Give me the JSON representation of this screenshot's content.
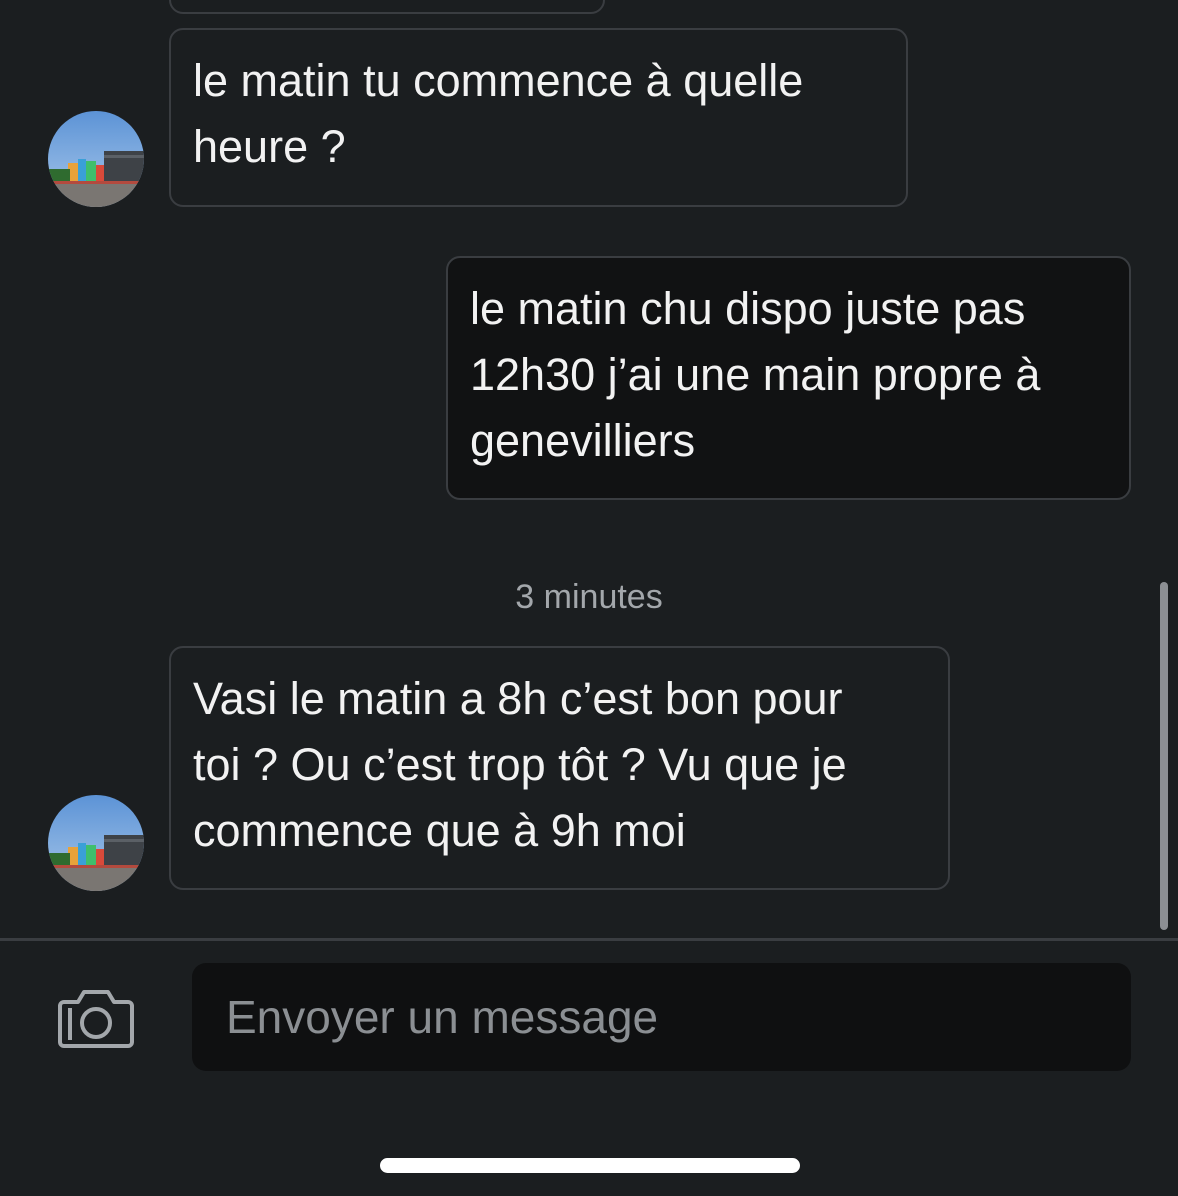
{
  "conversation": {
    "messages": [
      {
        "id": "m1",
        "direction": "incoming",
        "lines": [
          "le matin tu commence à quelle",
          "heure ?"
        ],
        "sender_avatar": "avatar-waterpark-photo"
      },
      {
        "id": "m2",
        "direction": "outgoing",
        "lines": [
          "le matin chu dispo juste pas",
          "12h30 j’ai une main propre à",
          "genevilliers"
        ]
      },
      {
        "id": "m3",
        "direction": "incoming",
        "lines": [
          "Vasi le matin a 8h c’est bon pour",
          "toi ? Ou c’est trop tôt ? Vu que je",
          "commence que à 9h moi"
        ],
        "sender_avatar": "avatar-waterpark-photo"
      }
    ],
    "timestamp_label": "3 minutes"
  },
  "composer": {
    "camera_icon": "camera-icon",
    "placeholder": "Envoyer un message",
    "value": ""
  },
  "colors": {
    "background": "#1b1e20",
    "bubble_border": "#3a3d41",
    "outgoing_bubble": "#111213",
    "input_background": "#0f1011",
    "text": "#f2f2f2",
    "muted_text": "#a3a7ab"
  }
}
